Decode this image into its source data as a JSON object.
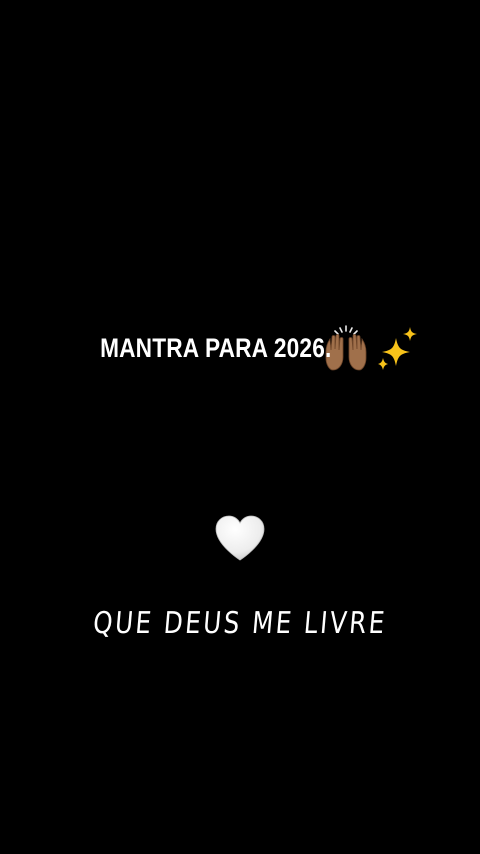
{
  "title": {
    "text": "MANTRA PARA 2026.",
    "emojis": [
      "raising-hands-icon",
      "sparkles-icon"
    ]
  },
  "heart": {
    "icon": "white-heart-icon",
    "color": "#f2f2f2"
  },
  "mantra": {
    "text": "QUE DEUS ME LIVRE"
  },
  "colors": {
    "background": "#000000",
    "text": "#ffffff",
    "skin": "#a0704b",
    "sparkle": "#f7c21a"
  }
}
